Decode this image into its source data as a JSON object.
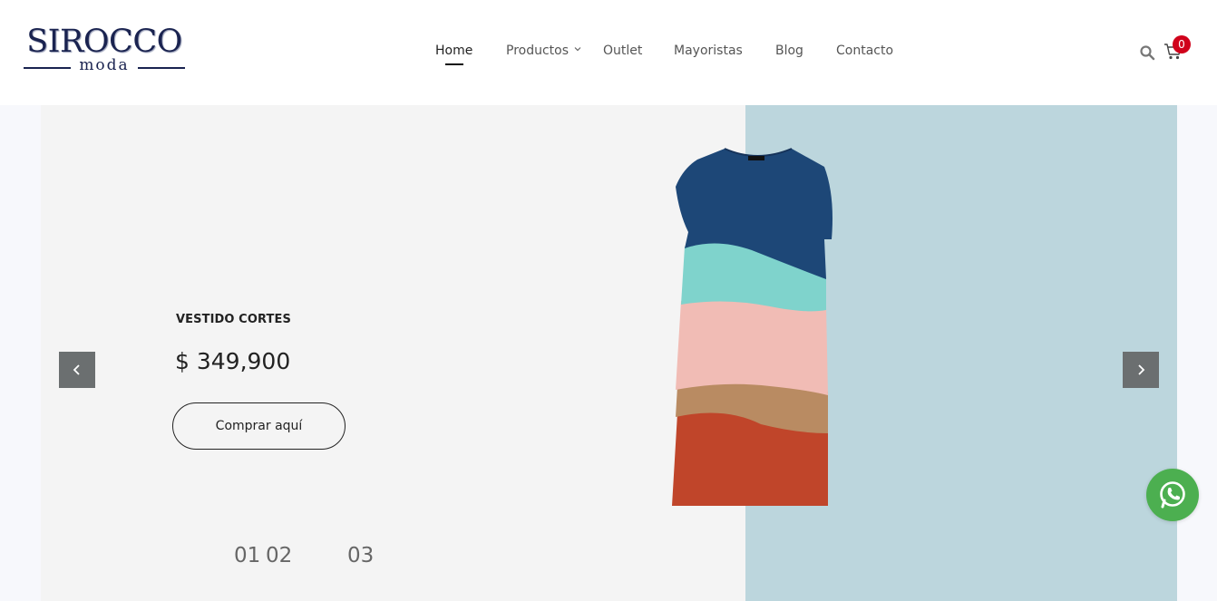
{
  "brand": {
    "name": "SIROCCO",
    "tagline": "moda"
  },
  "nav": {
    "items": [
      {
        "label": "Home",
        "active": true
      },
      {
        "label": "Productos",
        "active": false,
        "has_dropdown": true
      },
      {
        "label": "Outlet",
        "active": false
      },
      {
        "label": "Mayoristas",
        "active": false
      },
      {
        "label": "Blog",
        "active": false
      },
      {
        "label": "Contacto",
        "active": false
      }
    ]
  },
  "header_icons": {
    "search": "search-icon",
    "cart": "cart-icon",
    "cart_count": "0"
  },
  "hero": {
    "product_title": "VESTIDO CORTES",
    "price": "$ 349,900",
    "cta_label": "Comprar aquí",
    "slides": [
      "01",
      "02",
      "03"
    ],
    "prev_icon": "chevron-left-icon",
    "next_icon": "chevron-right-icon",
    "image": "dress-image"
  },
  "colors": {
    "brand": "#1a2350",
    "hero_bg": "#f4f4f4",
    "hero_panel": "#bcd6dd",
    "badge": "#d0021b",
    "whatsapp": "#4caf50"
  },
  "whatsapp": {
    "icon": "whatsapp-icon"
  }
}
